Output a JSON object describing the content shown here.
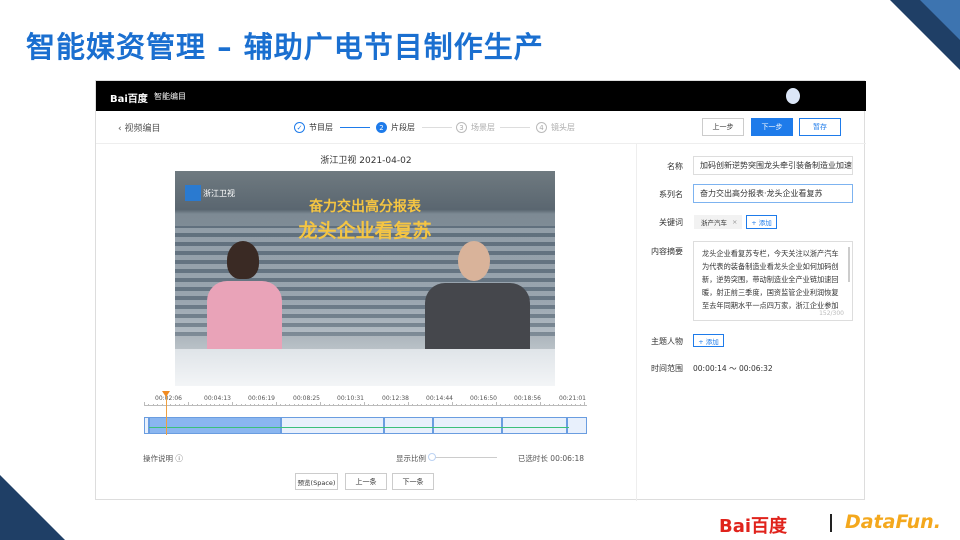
{
  "slide": {
    "title": "智能媒资管理 – 辅助广电节目制作生产"
  },
  "header": {
    "logo": "Bai百度",
    "app_name": "智能编目"
  },
  "toolbar": {
    "back_label": "视频编目",
    "steps": [
      {
        "num": "✓",
        "label": "节目层",
        "state": "done"
      },
      {
        "num": "2",
        "label": "片段层",
        "state": "active"
      },
      {
        "num": "3",
        "label": "场景层",
        "state": "pending"
      },
      {
        "num": "4",
        "label": "镜头层",
        "state": "pending"
      }
    ],
    "prev": "上一步",
    "next": "下一步",
    "save": "暂存"
  },
  "video": {
    "caption": "浙江卫视 2021-04-02",
    "channel_logo": "浙江卫视",
    "headline1": "奋力交出高分报表",
    "headline2": "龙头企业看复苏"
  },
  "timeline": {
    "ticks": [
      "00:02:06",
      "00:04:13",
      "00:06:19",
      "00:08:25",
      "00:10:31",
      "00:12:38",
      "00:14:44",
      "00:16:50",
      "00:18:56",
      "00:21:01"
    ],
    "help": "操作说明",
    "scale_label": "显示比例",
    "selected_label": "已选时长 00:06:18",
    "preview": "预览(Space)",
    "prev_item": "上一条",
    "next_item": "下一条"
  },
  "form": {
    "name_label": "名称",
    "name_value": "加码创新逆势突围龙头牵引装备制造业加速回",
    "series_label": "系列名",
    "series_value": "奋力交出高分报表·龙头企业看复苏",
    "keyword_label": "关键词",
    "keyword_tag": "浙产汽车",
    "add": "+ 添加",
    "summary_label": "内容摘要",
    "summary": "龙头企业看复苏专栏，今天关注以浙产汽车为代表的装备制造业看龙头企业如何加码创新，逆势突围，带动制造业全产业链加速回暖，射正前三季度，国资监管企业利润恢复至去年同期水平一点四万家，浙江企业参加",
    "counter": "152/300",
    "people_label": "主题人物",
    "time_label": "时间范围",
    "time_value": "00:00:14 ～ 00:06:32"
  },
  "footer": {
    "baidu": "Bai百度",
    "datafun": "DataFun."
  },
  "colors": {
    "primary": "#1a6fd0",
    "button": "#1e7bea"
  }
}
